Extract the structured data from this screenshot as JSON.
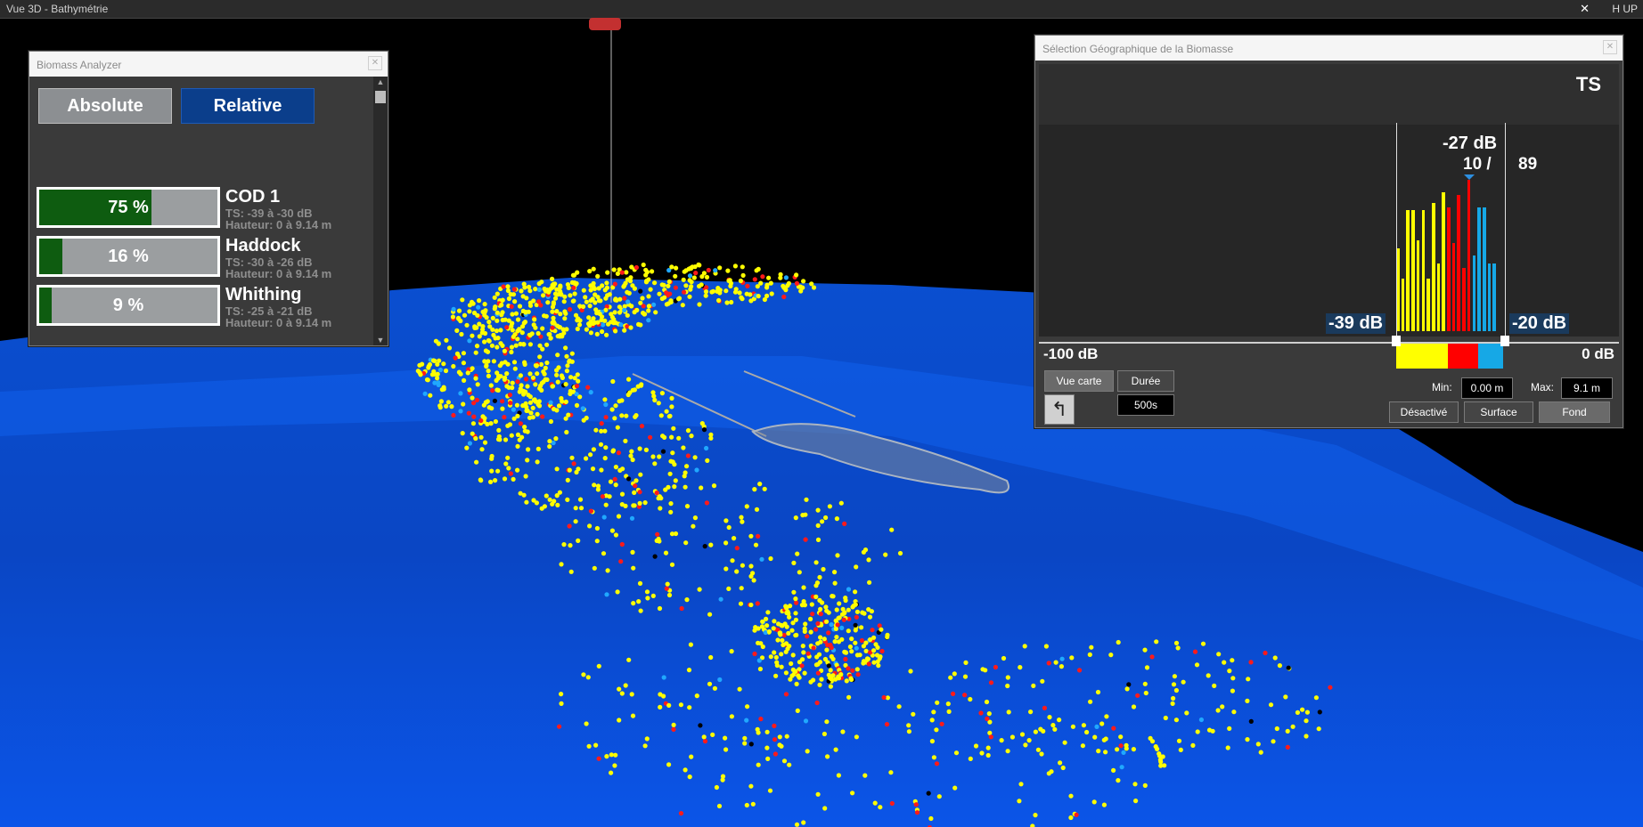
{
  "window": {
    "title": "Vue 3D - Bathymétrie",
    "close": "✕",
    "mode": "H UP"
  },
  "biomass": {
    "title": "Biomass Analyzer",
    "close": "✕",
    "tabs": {
      "absolute": "Absolute",
      "relative": "Relative"
    },
    "species": [
      {
        "name": "COD 1",
        "percent": "75 %",
        "fraction": 0.63,
        "ts": "TS: -39 à -30 dB",
        "height": "Hauteur: 0 à 9.14 m"
      },
      {
        "name": "Haddock",
        "percent": "16 %",
        "fraction": 0.13,
        "ts": "TS: -30 à -26 dB",
        "height": "Hauteur: 0 à 9.14 m"
      },
      {
        "name": "Whithing",
        "percent": "9 %",
        "fraction": 0.07,
        "ts": "TS: -25 à -21 dB",
        "height": "Hauteur: 0 à 9.14 m"
      }
    ]
  },
  "selection": {
    "title": "Sélection Géographique de la Biomasse",
    "close": "✕",
    "metric": "TS",
    "peak_db": "-27 dB",
    "count": "10 /",
    "total": "89",
    "min_db": "-39 dB",
    "max_db": "-20 dB",
    "range_left": "-100 dB",
    "range_right": "0 dB",
    "histogram": {
      "colors": [
        "#ffff00",
        "#ff0000",
        "#16a8e6"
      ],
      "bars": [
        {
          "c": 0,
          "v": 0.55
        },
        {
          "c": 0,
          "v": 0.35
        },
        {
          "c": 0,
          "v": 0.8
        },
        {
          "c": 0,
          "v": 0.8
        },
        {
          "c": 0,
          "v": 0.6
        },
        {
          "c": 0,
          "v": 0.8
        },
        {
          "c": 0,
          "v": 0.35
        },
        {
          "c": 0,
          "v": 0.85
        },
        {
          "c": 0,
          "v": 0.45
        },
        {
          "c": 0,
          "v": 0.92
        },
        {
          "c": 1,
          "v": 0.82
        },
        {
          "c": 1,
          "v": 0.58
        },
        {
          "c": 1,
          "v": 0.9
        },
        {
          "c": 1,
          "v": 0.42
        },
        {
          "c": 1,
          "v": 1.0
        },
        {
          "c": 2,
          "v": 0.5
        },
        {
          "c": 2,
          "v": 0.82
        },
        {
          "c": 2,
          "v": 0.82
        },
        {
          "c": 2,
          "v": 0.45
        },
        {
          "c": 2,
          "v": 0.45
        }
      ]
    },
    "buttons": {
      "map_view": "Vue carte",
      "duration": "Durée",
      "duration_value": "500s",
      "disabled": "Désactivé",
      "surface": "Surface",
      "bottom": "Fond"
    },
    "min_label": "Min:",
    "min_value": "0.00 m",
    "max_label": "Max:",
    "max_value": "9.1 m"
  }
}
